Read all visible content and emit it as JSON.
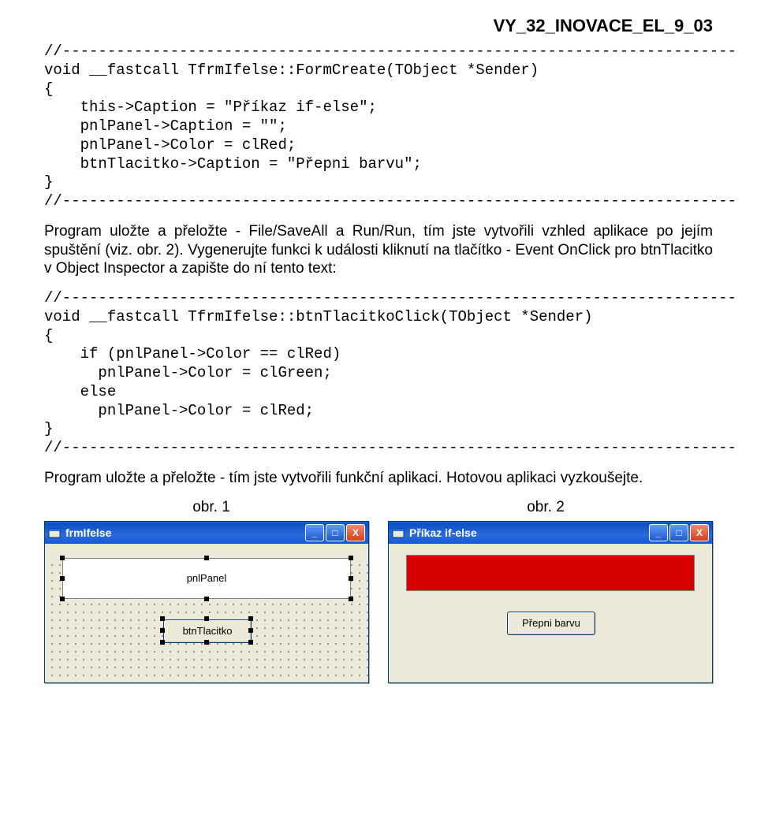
{
  "header_id": "VY_32_INOVACE_EL_9_03",
  "code_block_1": "//---------------------------------------------------------------------------\nvoid __fastcall TfrmIfelse::FormCreate(TObject *Sender)\n{\n    this->Caption = \"Příkaz if-else\";\n    pnlPanel->Caption = \"\";\n    pnlPanel->Color = clRed;\n    btnTlacitko->Caption = \"Přepni barvu\";\n}\n//---------------------------------------------------------------------------",
  "paragraph_1": "Program uložte a přeložte - File/SaveAll a Run/Run, tím jste vytvořili vzhled aplikace po jejím spuštění (viz. obr. 2). Vygenerujte funkci k události kliknutí na tlačítko - Event OnClick pro btnTlacitko v Object Inspector a zapište do ní tento text:",
  "code_block_2": "//---------------------------------------------------------------------------\nvoid __fastcall TfrmIfelse::btnTlacitkoClick(TObject *Sender)\n{\n    if (pnlPanel->Color == clRed)\n      pnlPanel->Color = clGreen;\n    else\n      pnlPanel->Color = clRed;\n}\n//---------------------------------------------------------------------------",
  "paragraph_2": "Program uložte a přeložte - tím jste vytvořili funkční aplikaci. Hotovou aplikaci vyzkoušejte.",
  "fig1_label": "obr. 1",
  "fig2_label": "obr. 2",
  "win1": {
    "title": "frmIfelse",
    "panel_caption": "pnlPanel",
    "button_caption": "btnTlacitko"
  },
  "win2": {
    "title": "Příkaz if-else",
    "button_caption": "Přepni barvu"
  },
  "glyphs": {
    "min": "_",
    "max": "□",
    "close": "X"
  }
}
